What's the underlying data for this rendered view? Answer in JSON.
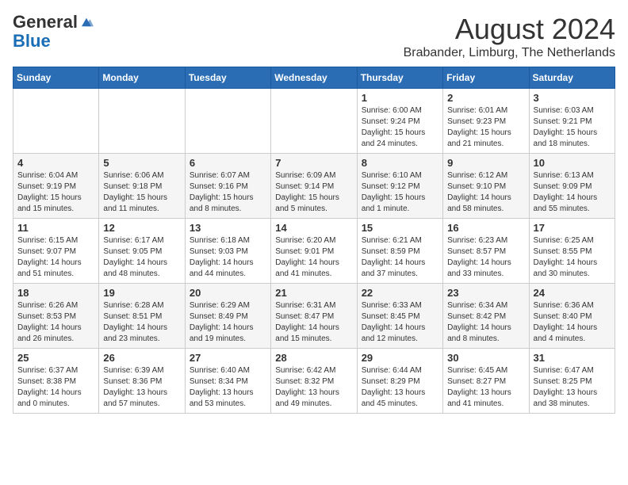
{
  "header": {
    "logo_general": "General",
    "logo_blue": "Blue",
    "title": "August 2024",
    "subtitle": "Brabander, Limburg, The Netherlands"
  },
  "calendar": {
    "days_of_week": [
      "Sunday",
      "Monday",
      "Tuesday",
      "Wednesday",
      "Thursday",
      "Friday",
      "Saturday"
    ],
    "weeks": [
      [
        {
          "day": "",
          "info": ""
        },
        {
          "day": "",
          "info": ""
        },
        {
          "day": "",
          "info": ""
        },
        {
          "day": "",
          "info": ""
        },
        {
          "day": "1",
          "info": "Sunrise: 6:00 AM\nSunset: 9:24 PM\nDaylight: 15 hours and 24 minutes."
        },
        {
          "day": "2",
          "info": "Sunrise: 6:01 AM\nSunset: 9:23 PM\nDaylight: 15 hours and 21 minutes."
        },
        {
          "day": "3",
          "info": "Sunrise: 6:03 AM\nSunset: 9:21 PM\nDaylight: 15 hours and 18 minutes."
        }
      ],
      [
        {
          "day": "4",
          "info": "Sunrise: 6:04 AM\nSunset: 9:19 PM\nDaylight: 15 hours and 15 minutes."
        },
        {
          "day": "5",
          "info": "Sunrise: 6:06 AM\nSunset: 9:18 PM\nDaylight: 15 hours and 11 minutes."
        },
        {
          "day": "6",
          "info": "Sunrise: 6:07 AM\nSunset: 9:16 PM\nDaylight: 15 hours and 8 minutes."
        },
        {
          "day": "7",
          "info": "Sunrise: 6:09 AM\nSunset: 9:14 PM\nDaylight: 15 hours and 5 minutes."
        },
        {
          "day": "8",
          "info": "Sunrise: 6:10 AM\nSunset: 9:12 PM\nDaylight: 15 hours and 1 minute."
        },
        {
          "day": "9",
          "info": "Sunrise: 6:12 AM\nSunset: 9:10 PM\nDaylight: 14 hours and 58 minutes."
        },
        {
          "day": "10",
          "info": "Sunrise: 6:13 AM\nSunset: 9:09 PM\nDaylight: 14 hours and 55 minutes."
        }
      ],
      [
        {
          "day": "11",
          "info": "Sunrise: 6:15 AM\nSunset: 9:07 PM\nDaylight: 14 hours and 51 minutes."
        },
        {
          "day": "12",
          "info": "Sunrise: 6:17 AM\nSunset: 9:05 PM\nDaylight: 14 hours and 48 minutes."
        },
        {
          "day": "13",
          "info": "Sunrise: 6:18 AM\nSunset: 9:03 PM\nDaylight: 14 hours and 44 minutes."
        },
        {
          "day": "14",
          "info": "Sunrise: 6:20 AM\nSunset: 9:01 PM\nDaylight: 14 hours and 41 minutes."
        },
        {
          "day": "15",
          "info": "Sunrise: 6:21 AM\nSunset: 8:59 PM\nDaylight: 14 hours and 37 minutes."
        },
        {
          "day": "16",
          "info": "Sunrise: 6:23 AM\nSunset: 8:57 PM\nDaylight: 14 hours and 33 minutes."
        },
        {
          "day": "17",
          "info": "Sunrise: 6:25 AM\nSunset: 8:55 PM\nDaylight: 14 hours and 30 minutes."
        }
      ],
      [
        {
          "day": "18",
          "info": "Sunrise: 6:26 AM\nSunset: 8:53 PM\nDaylight: 14 hours and 26 minutes."
        },
        {
          "day": "19",
          "info": "Sunrise: 6:28 AM\nSunset: 8:51 PM\nDaylight: 14 hours and 23 minutes."
        },
        {
          "day": "20",
          "info": "Sunrise: 6:29 AM\nSunset: 8:49 PM\nDaylight: 14 hours and 19 minutes."
        },
        {
          "day": "21",
          "info": "Sunrise: 6:31 AM\nSunset: 8:47 PM\nDaylight: 14 hours and 15 minutes."
        },
        {
          "day": "22",
          "info": "Sunrise: 6:33 AM\nSunset: 8:45 PM\nDaylight: 14 hours and 12 minutes."
        },
        {
          "day": "23",
          "info": "Sunrise: 6:34 AM\nSunset: 8:42 PM\nDaylight: 14 hours and 8 minutes."
        },
        {
          "day": "24",
          "info": "Sunrise: 6:36 AM\nSunset: 8:40 PM\nDaylight: 14 hours and 4 minutes."
        }
      ],
      [
        {
          "day": "25",
          "info": "Sunrise: 6:37 AM\nSunset: 8:38 PM\nDaylight: 14 hours and 0 minutes."
        },
        {
          "day": "26",
          "info": "Sunrise: 6:39 AM\nSunset: 8:36 PM\nDaylight: 13 hours and 57 minutes."
        },
        {
          "day": "27",
          "info": "Sunrise: 6:40 AM\nSunset: 8:34 PM\nDaylight: 13 hours and 53 minutes."
        },
        {
          "day": "28",
          "info": "Sunrise: 6:42 AM\nSunset: 8:32 PM\nDaylight: 13 hours and 49 minutes."
        },
        {
          "day": "29",
          "info": "Sunrise: 6:44 AM\nSunset: 8:29 PM\nDaylight: 13 hours and 45 minutes."
        },
        {
          "day": "30",
          "info": "Sunrise: 6:45 AM\nSunset: 8:27 PM\nDaylight: 13 hours and 41 minutes."
        },
        {
          "day": "31",
          "info": "Sunrise: 6:47 AM\nSunset: 8:25 PM\nDaylight: 13 hours and 38 minutes."
        }
      ]
    ]
  }
}
